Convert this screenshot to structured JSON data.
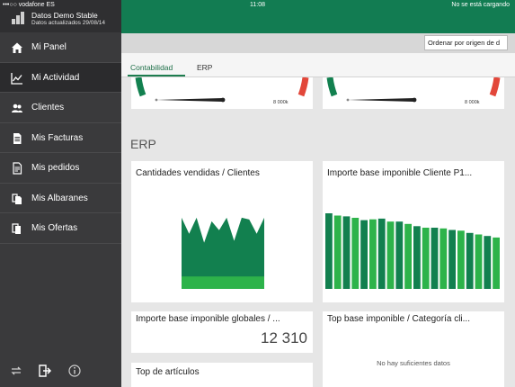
{
  "status_bar": {
    "carrier": "•••○○ vodafone ES",
    "time": "11:08",
    "battery": "No se está cargando"
  },
  "profile": {
    "title": "Datos Demo Stable",
    "subtitle": "Datos actualizados 29/08/14"
  },
  "sidebar": {
    "items": [
      {
        "label": "Mi Panel",
        "icon": "home-icon"
      },
      {
        "label": "Mi Actividad",
        "icon": "activity-chart-icon"
      },
      {
        "label": "Clientes",
        "icon": "users-icon"
      },
      {
        "label": "Mis Facturas",
        "icon": "invoice-icon"
      },
      {
        "label": "Mis pedidos",
        "icon": "order-icon"
      },
      {
        "label": "Mis Albaranes",
        "icon": "delivery-note-icon"
      },
      {
        "label": "Mis Ofertas",
        "icon": "offer-icon"
      }
    ],
    "active_index": 1,
    "footer_icons": [
      "sync-icon",
      "logout-icon",
      "info-icon"
    ]
  },
  "sort": {
    "label": "Ordenar por origen de d"
  },
  "tabs": [
    {
      "label": "Contabilidad",
      "active": true
    },
    {
      "label": "ERP",
      "active": false
    }
  ],
  "gauges": [
    {
      "max_label": "8 000k"
    },
    {
      "max_label": "8 000k"
    }
  ],
  "section": {
    "title": "ERP"
  },
  "cards": {
    "card1": {
      "title": "Cantidades vendidas / Clientes"
    },
    "card2": {
      "title": "Importe base imponible Cliente P1..."
    },
    "card3": {
      "title": "Importe base imponible globales / ...",
      "value": "12 310"
    },
    "card4": {
      "title": "Top base imponible / Categoría cli...",
      "empty": "No hay suficientes datos"
    },
    "card5": {
      "title": "Top de artículos"
    }
  },
  "colors": {
    "brand": "#127c52",
    "dark_green": "#12804f",
    "light_green": "#2db34a",
    "gauge_red": "#e2473a"
  },
  "chart_data": [
    {
      "type": "area",
      "title": "",
      "series": [
        {
          "values": [
            8,
            6.2,
            8,
            5.2,
            7.6,
            6.6,
            8,
            5.4,
            8,
            7.8,
            6.2,
            8
          ]
        },
        {
          "values": [
            1,
            1,
            1,
            1,
            1,
            1,
            1,
            1,
            1,
            1,
            1,
            1
          ]
        }
      ],
      "ylim": [
        0,
        8.5
      ]
    },
    {
      "type": "bar",
      "title": "",
      "series": [
        {
          "values": [
            10.0,
            9.7,
            9.6,
            9.4,
            9.1,
            9.2,
            9.3,
            8.9,
            8.9,
            8.6,
            8.3,
            8.1,
            8.1,
            8.0,
            7.8,
            7.7,
            7.4,
            7.2,
            7.0,
            6.8
          ]
        }
      ],
      "ylim": [
        0,
        10
      ]
    }
  ]
}
